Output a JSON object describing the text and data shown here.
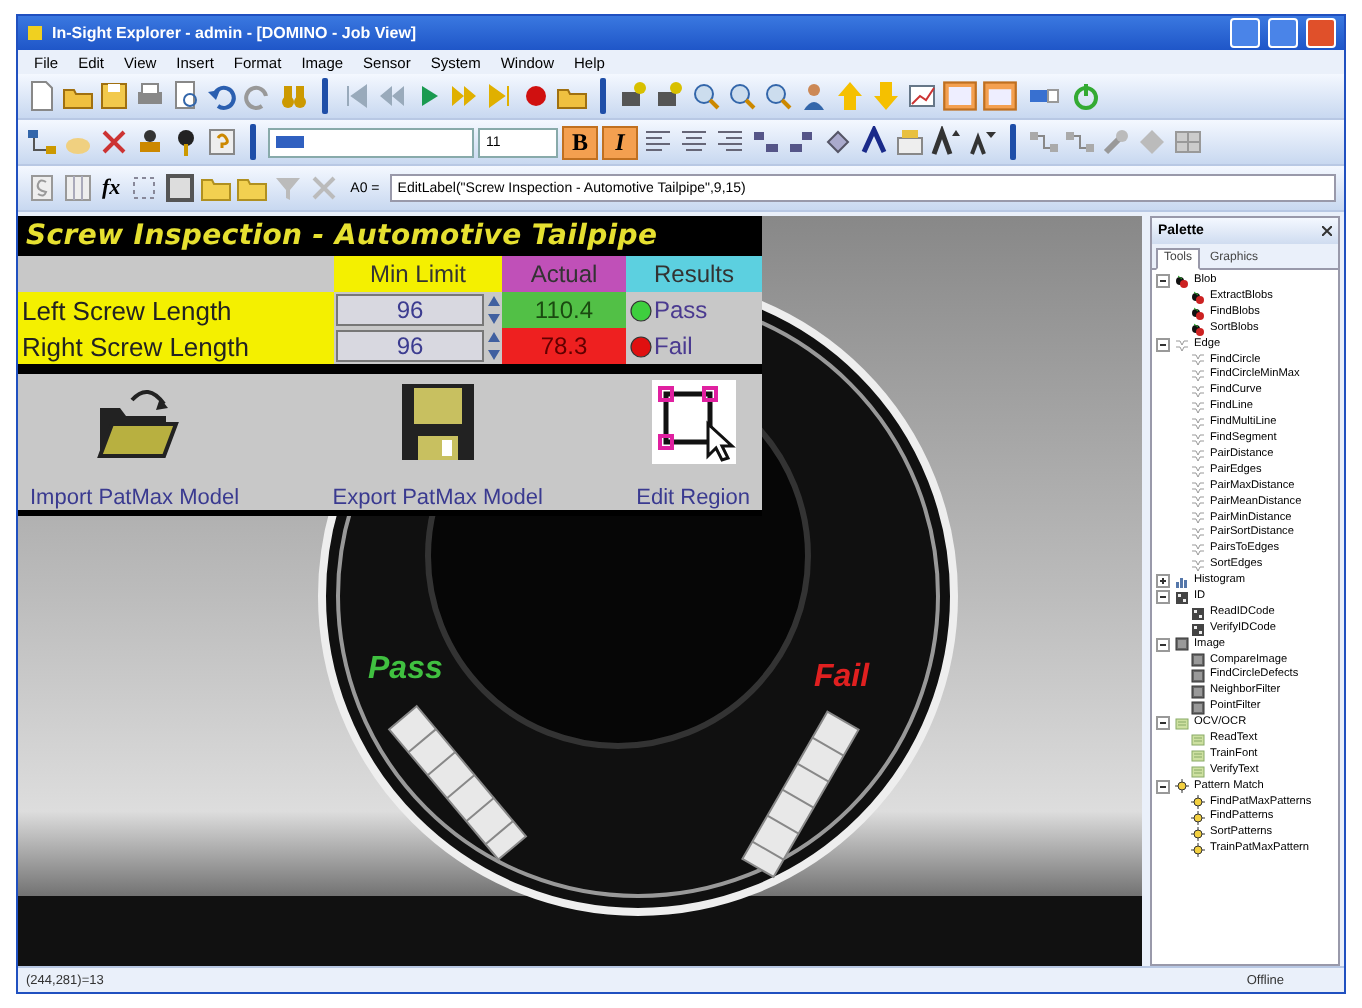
{
  "window": {
    "title": "In-Sight Explorer - admin - [DOMINO - Job View]"
  },
  "menu": [
    "File",
    "Edit",
    "View",
    "Insert",
    "Format",
    "Image",
    "Sensor",
    "System",
    "Window",
    "Help"
  ],
  "format_toolbar": {
    "font_size": "11",
    "bold": {
      "label": "B",
      "on": true
    },
    "italic": {
      "label": "I",
      "on": true
    }
  },
  "formula_bar": {
    "function_label": "fx",
    "cell": "A0 =",
    "value": "EditLabel(\"Screw Inspection - Automotive Tailpipe\",9,15)"
  },
  "spreadsheet": {
    "title": "Screw Inspection - Automotive Tailpipe",
    "columns": [
      {
        "label": "Min Limit",
        "color": "#f4f000"
      },
      {
        "label": "Actual",
        "color": "#c050b8"
      },
      {
        "label": "Results",
        "color": "#5cd0e0"
      }
    ],
    "rows": [
      {
        "label": "Left Screw Length",
        "min_limit": "96",
        "actual": "110.4",
        "result": "Pass",
        "passed": true
      },
      {
        "label": "Right Screw Length",
        "min_limit": "96",
        "actual": "78.3",
        "result": "Fail",
        "passed": false
      }
    ],
    "buttons": [
      {
        "label": "Import PatMax Model",
        "kind": "import"
      },
      {
        "label": "Export PatMax Model",
        "kind": "export"
      },
      {
        "label": "Edit Region",
        "kind": "region"
      }
    ]
  },
  "image_labels": [
    {
      "text": "Pass",
      "passed": true
    },
    {
      "text": "Fail",
      "passed": false
    }
  ],
  "palette": {
    "title": "Palette",
    "tabs": [
      {
        "label": "Tools",
        "selected": true
      },
      {
        "label": "Graphics",
        "selected": false
      }
    ],
    "tree": [
      {
        "label": "Blob",
        "kind": "blob",
        "expanded": true,
        "children": [
          {
            "label": "ExtractBlobs",
            "kind": "blob"
          },
          {
            "label": "FindBlobs",
            "kind": "blob"
          },
          {
            "label": "SortBlobs",
            "kind": "blob"
          }
        ]
      },
      {
        "label": "Edge",
        "kind": "edge",
        "expanded": true,
        "children": [
          {
            "label": "FindCircle",
            "kind": "edge"
          },
          {
            "label": "FindCircleMinMax",
            "kind": "edge"
          },
          {
            "label": "FindCurve",
            "kind": "edge"
          },
          {
            "label": "FindLine",
            "kind": "edge"
          },
          {
            "label": "FindMultiLine",
            "kind": "edge"
          },
          {
            "label": "FindSegment",
            "kind": "edge"
          },
          {
            "label": "PairDistance",
            "kind": "edge"
          },
          {
            "label": "PairEdges",
            "kind": "edge"
          },
          {
            "label": "PairMaxDistance",
            "kind": "edge"
          },
          {
            "label": "PairMeanDistance",
            "kind": "edge"
          },
          {
            "label": "PairMinDistance",
            "kind": "edge"
          },
          {
            "label": "PairSortDistance",
            "kind": "edge"
          },
          {
            "label": "PairsToEdges",
            "kind": "edge"
          },
          {
            "label": "SortEdges",
            "kind": "edge"
          }
        ]
      },
      {
        "label": "Histogram",
        "kind": "histogram",
        "expanded": false
      },
      {
        "label": "ID",
        "kind": "id",
        "expanded": true,
        "children": [
          {
            "label": "ReadIDCode",
            "kind": "id"
          },
          {
            "label": "VerifyIDCode",
            "kind": "id"
          }
        ]
      },
      {
        "label": "Image",
        "kind": "image",
        "expanded": true,
        "children": [
          {
            "label": "CompareImage",
            "kind": "image"
          },
          {
            "label": "FindCircleDefects",
            "kind": "image"
          },
          {
            "label": "NeighborFilter",
            "kind": "image"
          },
          {
            "label": "PointFilter",
            "kind": "image"
          }
        ]
      },
      {
        "label": "OCV/OCR",
        "kind": "ocr",
        "expanded": true,
        "children": [
          {
            "label": "ReadText",
            "kind": "ocr"
          },
          {
            "label": "TrainFont",
            "kind": "ocr"
          },
          {
            "label": "VerifyText",
            "kind": "ocr"
          }
        ]
      },
      {
        "label": "Pattern Match",
        "kind": "pattern",
        "expanded": true,
        "children": [
          {
            "label": "FindPatMaxPatterns",
            "kind": "pattern"
          },
          {
            "label": "FindPatterns",
            "kind": "pattern"
          },
          {
            "label": "SortPatterns",
            "kind": "pattern"
          },
          {
            "label": "TrainPatMaxPattern",
            "kind": "pattern"
          }
        ]
      }
    ]
  },
  "status_bar": {
    "coordinates": "(244,281)=13",
    "state": "Offline"
  }
}
